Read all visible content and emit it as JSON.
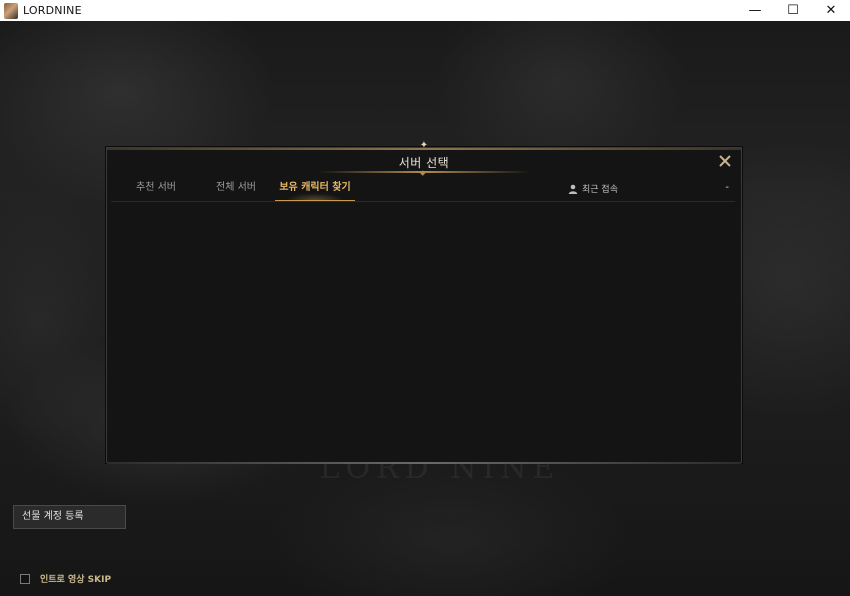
{
  "window": {
    "title": "LORDNINE",
    "controls": {
      "minimize": "—",
      "maximize": "☐",
      "close": "✕"
    }
  },
  "background": {
    "logo_text": "LORD NINE"
  },
  "modal": {
    "title": "서버 선택",
    "tabs": [
      {
        "label": "추천 서버",
        "active": false
      },
      {
        "label": "전체 서버",
        "active": false
      },
      {
        "label": "보유 캐릭터 찾기",
        "active": true
      }
    ],
    "recent_label": "최근 접속",
    "recent_value": "-",
    "accent_color": "#e8b866"
  },
  "bottom": {
    "gift_button": "선물 계정 등록",
    "skip_label": "인트로 영상 SKIP",
    "skip_checked": false
  }
}
